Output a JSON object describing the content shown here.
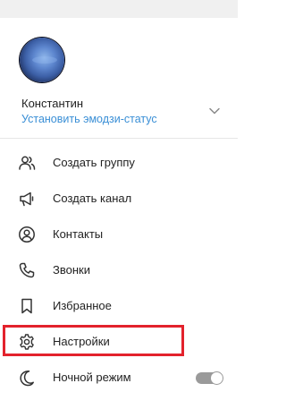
{
  "profile": {
    "name": "Константин",
    "status_link": "Установить эмодзи-статус"
  },
  "menu": {
    "items": [
      {
        "label": "Создать группу",
        "icon": "group-icon"
      },
      {
        "label": "Создать канал",
        "icon": "megaphone-icon"
      },
      {
        "label": "Контакты",
        "icon": "contact-icon"
      },
      {
        "label": "Звонки",
        "icon": "phone-icon"
      },
      {
        "label": "Избранное",
        "icon": "bookmark-icon"
      },
      {
        "label": "Настройки",
        "icon": "gear-icon"
      },
      {
        "label": "Ночной режим",
        "icon": "moon-icon"
      }
    ]
  },
  "night_mode": {
    "enabled": false
  },
  "highlighted_item": "Настройки",
  "colors": {
    "accent_link": "#3a8fd6",
    "highlight_border": "#e3222c",
    "icon": "#333333"
  }
}
